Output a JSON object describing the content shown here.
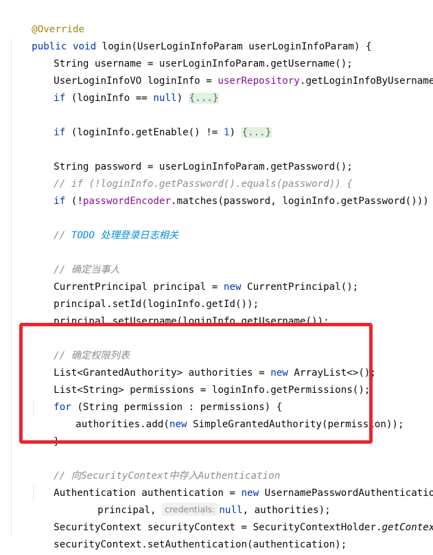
{
  "code": {
    "l1_annotation": "@Override",
    "l2_kw": "public void",
    "l2_rest": " login(UserLoginInfoParam userLoginInfoParam) {",
    "l3": "String username = userLoginInfoParam.getUsername();",
    "l4_a": "UserLoginInfoVO loginInfo = ",
    "l4_field": "userRepository",
    "l4_b": ".getLoginInfoByUsername(username",
    "l5_kw": "if",
    "l5_a": " (loginInfo == ",
    "l5_null": "null",
    "l5_b": ") ",
    "fold": "{...}",
    "l6_kw": "if",
    "l6_a": " (loginInfo.getEnable() != ",
    "l6_num": "1",
    "l6_b": ") ",
    "l7": "String password = userLoginInfoParam.getPassword();",
    "l8_comment": "// if (!loginInfo.getPassword().equals(password)) {",
    "l9_kw": "if",
    "l9_a": " (!",
    "l9_field": "passwordEncoder",
    "l9_b": ".matches(password, loginInfo.getPassword())) ",
    "l10_comment_prefix": "// ",
    "l10_todo": "TODO 处理登录日志相关",
    "l11_comment": "// 确定当事人",
    "l12_a": "CurrentPrincipal principal = ",
    "l12_kw": "new",
    "l12_b": " CurrentPrincipal();",
    "l13": "principal.setId(loginInfo.getId());",
    "l14": "principal.setUsername(loginInfo.getUsername());",
    "l15_comment": "// 确定权限列表",
    "l16_a": "List<GrantedAuthority> authorities = ",
    "l16_kw": "new",
    "l16_b": " ArrayList<>();",
    "l17": "List<String> permissions = loginInfo.getPermissions();",
    "l18_kw": "for",
    "l18_rest": " (String permission : permissions) {",
    "l19_a": "authorities.add(",
    "l19_kw": "new",
    "l19_b": " SimpleGrantedAuthority(permission));",
    "l20": "}",
    "l21_comment": "// 向SecurityContext中存入Authentication",
    "l22_a": "Authentication authentication = ",
    "l22_kw": "new",
    "l22_b": " UsernamePasswordAuthenticationToken(",
    "l23_a": "principal, ",
    "l23_hint": "credentials:",
    "l23_null": "null",
    "l23_b": ", authorities);",
    "l24_a": "SecurityContext securityContext = SecurityContextHolder.",
    "l24_it": "getContext",
    "l24_b": "();",
    "l25": "securityContext.setAuthentication(authentication);",
    "l26": "}"
  },
  "colors": {
    "keyword": "#0033b3",
    "annotation": "#9e880d",
    "field": "#871094",
    "number": "#1750eb",
    "comment": "#8c8c8c",
    "todo": "#008dde",
    "highlight_border": "#e8262d"
  }
}
